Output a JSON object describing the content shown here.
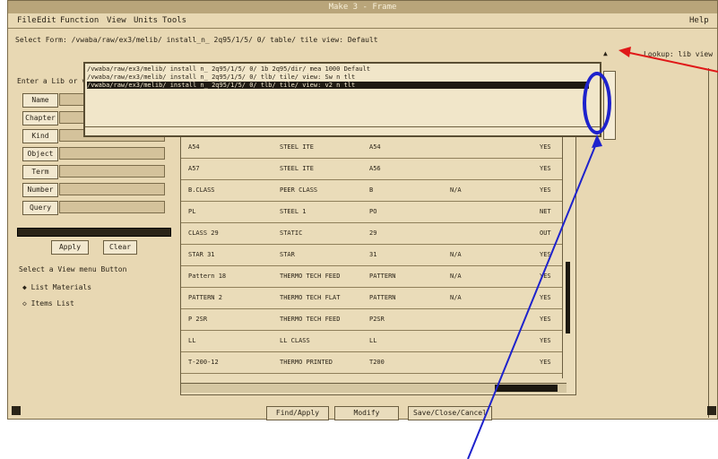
{
  "window": {
    "title": "Make 3 - Frame"
  },
  "menubar": {
    "file": "File",
    "edit": "Edit",
    "function": "Function",
    "view": "View",
    "units": "Units",
    "tools": "Tools",
    "help": "Help"
  },
  "select_form": "Select Form: /vwaba/raw/ex3/melib/ install_n_ 2q95/1/5/ 0/ table/ tile view: Default",
  "dropdown": {
    "line1": "/vwaba/raw/ex3/melib/ install n_ 2q95/1/5/ 0/ 1b 2q95/dir/ mea 1000 Default",
    "line2": "/vwaba/raw/ex3/melib/ install n_ 2q95/1/5/ 0/ tlb/ tile/ view: Sw n tlt",
    "line3": "/vwaba/raw/ex3/melib/ install n_ 2q95/1/5/ 0/ tlb/ tile/ view: v2 n tlt"
  },
  "lookup": "Lookup:   lib view",
  "left_panel": {
    "entry_label": "Enter a Lib or value",
    "fields": [
      "Name",
      "Chapter",
      "Kind",
      "Object",
      "Term",
      "Number",
      "Query"
    ],
    "apply": "Apply",
    "clear": "Clear",
    "select_label": "Select a View menu Button",
    "radio1": "List Materials",
    "radio2": "Items List"
  },
  "table": {
    "rows": [
      [
        "A54",
        "STEEL ITE",
        "A54",
        "",
        "YES"
      ],
      [
        "A57",
        "STEEL ITE",
        "A56",
        "",
        "YES"
      ],
      [
        "B.CLASS",
        "PEER CLASS",
        "B",
        "N/A",
        "YES"
      ],
      [
        "PL",
        "STEEL 1",
        "PO",
        "",
        "NET"
      ],
      [
        "CLASS 29",
        "STATIC",
        "29",
        "",
        "OUT"
      ],
      [
        "STAR 31",
        "STAR",
        "31",
        "N/A",
        "YES"
      ],
      [
        "Pattern 18",
        "THERMO TECH FEED",
        "PATTERN",
        "N/A",
        "YES"
      ],
      [
        "PATTERN 2",
        "THERMO TECH FLAT",
        "PATTERN",
        "N/A",
        "YES"
      ],
      [
        "P 2SR",
        "THERMO TECH FEED",
        "P2SR",
        "",
        "YES"
      ],
      [
        "LL",
        "LL CLASS",
        "LL",
        "",
        "YES"
      ],
      [
        "T-200-12",
        "THERMO PRINTED",
        "T200",
        "",
        "YES"
      ]
    ]
  },
  "bottom_buttons": [
    "Find/Apply",
    "Modify",
    "Save/Close/Cancel"
  ]
}
